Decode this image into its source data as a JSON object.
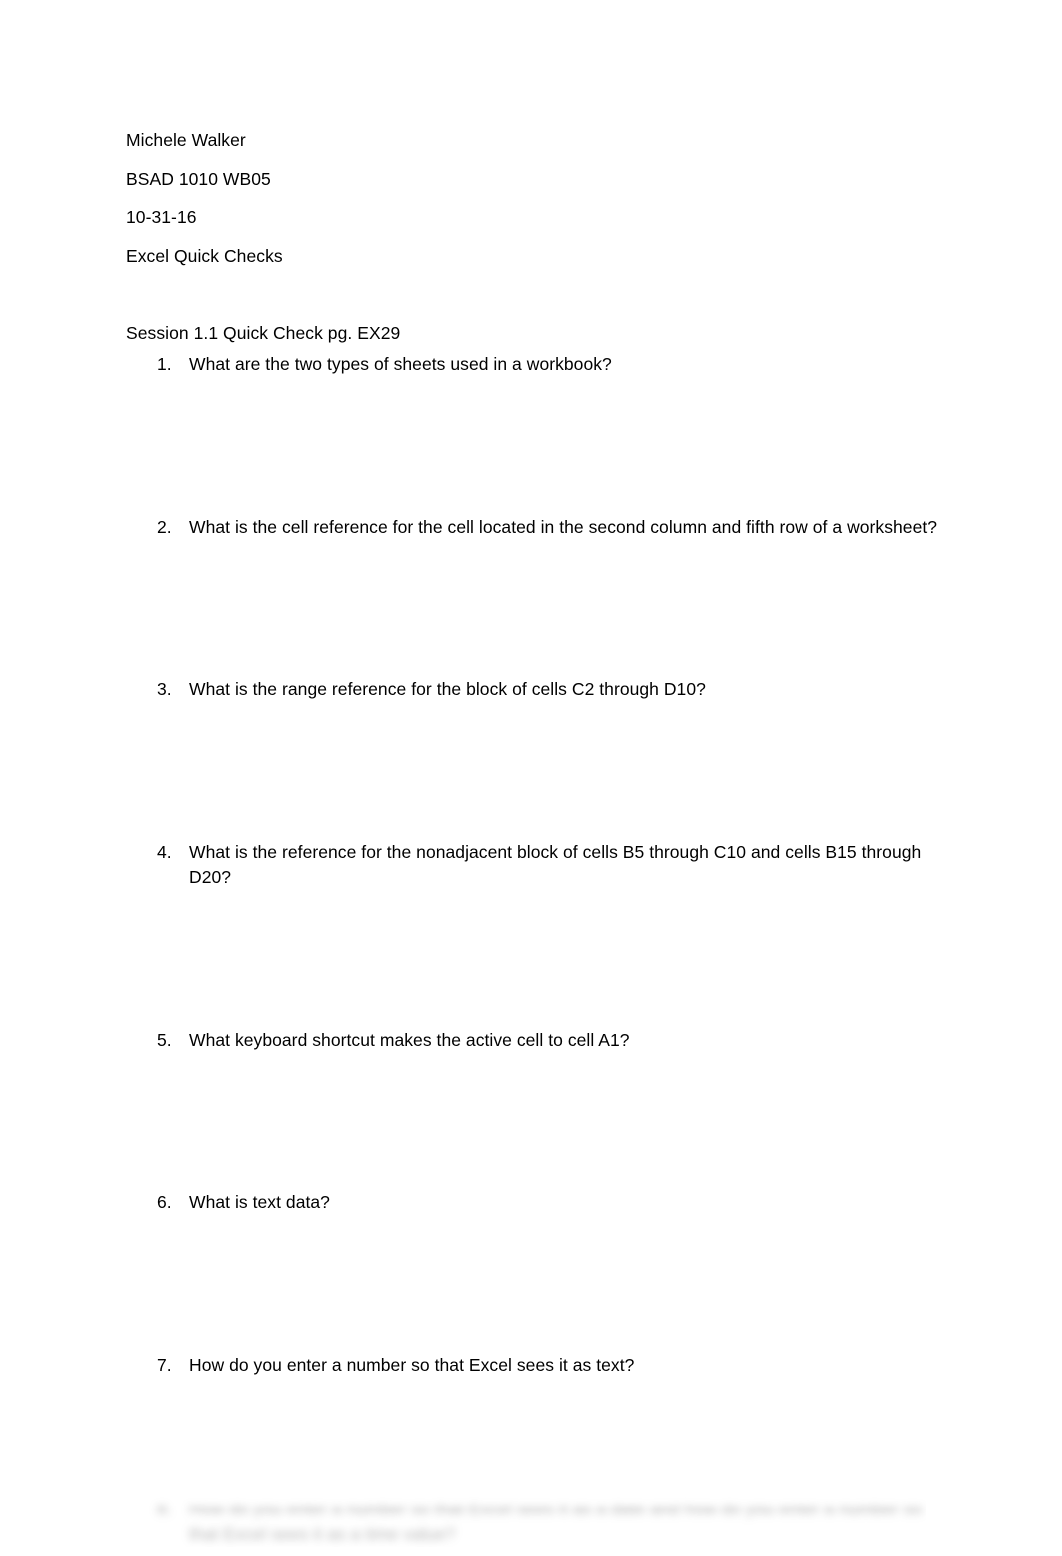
{
  "document": {
    "background_color": "#ffffff",
    "text_color": "#000000",
    "header": {
      "author": "Michele Walker",
      "course": "BSAD 1010 WB05",
      "date": "10-31-16",
      "assignment": "Excel Quick Checks"
    },
    "section": {
      "heading": "Session 1.1 Quick Check pg. EX29",
      "questions": [
        {
          "number": "1.",
          "text": "What are the two types of sheets used in a workbook?"
        },
        {
          "number": "2.",
          "text": "What is the cell reference for the cell located in the second column and fifth row of a worksheet?"
        },
        {
          "number": "3.",
          "text": "What is the range reference for the block of cells C2 through D10?"
        },
        {
          "number": "4.",
          "text": "What is the reference for the nonadjacent block of cells B5 through C10 and cells B15 through D20?"
        },
        {
          "number": "5.",
          "text": "What keyboard shortcut makes the active cell to cell A1?"
        },
        {
          "number": "6.",
          "text": "What is text data?"
        },
        {
          "number": "7.",
          "text": "How do you enter a number so that Excel sees it as text?"
        }
      ]
    },
    "cutoff": {
      "number": "8.",
      "text": "How do you enter a number so that Excel sees it as a date and how do you enter a number so that Excel sees it as a time value?"
    }
  }
}
